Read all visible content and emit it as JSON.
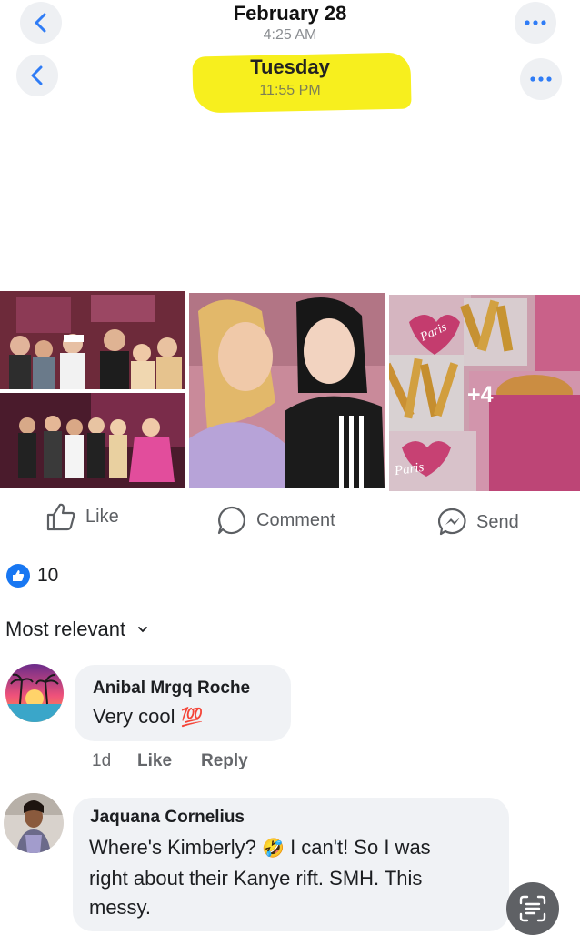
{
  "header_top": {
    "date": "February 28",
    "time": "4:25 AM"
  },
  "header_second": {
    "day": "Tuesday",
    "time": "11:55 PM"
  },
  "photos": {
    "more_count": "+4",
    "box_label_1": "Paris",
    "box_label_2": "Paris"
  },
  "actions": {
    "like": "Like",
    "comment": "Comment",
    "send": "Send"
  },
  "reactions": {
    "count": "10"
  },
  "sort": {
    "label": "Most relevant"
  },
  "comments": [
    {
      "author": "Anibal Mrgq Roche",
      "text": "Very cool",
      "emoji": "💯",
      "age": "1d",
      "like": "Like",
      "reply": "Reply"
    },
    {
      "author": "Jaquana Cornelius",
      "line1_a": "Where's Kimberly?",
      "emoji": "🤣",
      "line1_b": "I can't! So I was",
      "line2": "right about their Kanye rift. SMH. This",
      "line3": "messy."
    }
  ],
  "colors": {
    "accent": "#1877f2",
    "highlight": "#f7ef1e",
    "bubble": "#f0f2f5",
    "icon": "#2f7cf6"
  }
}
